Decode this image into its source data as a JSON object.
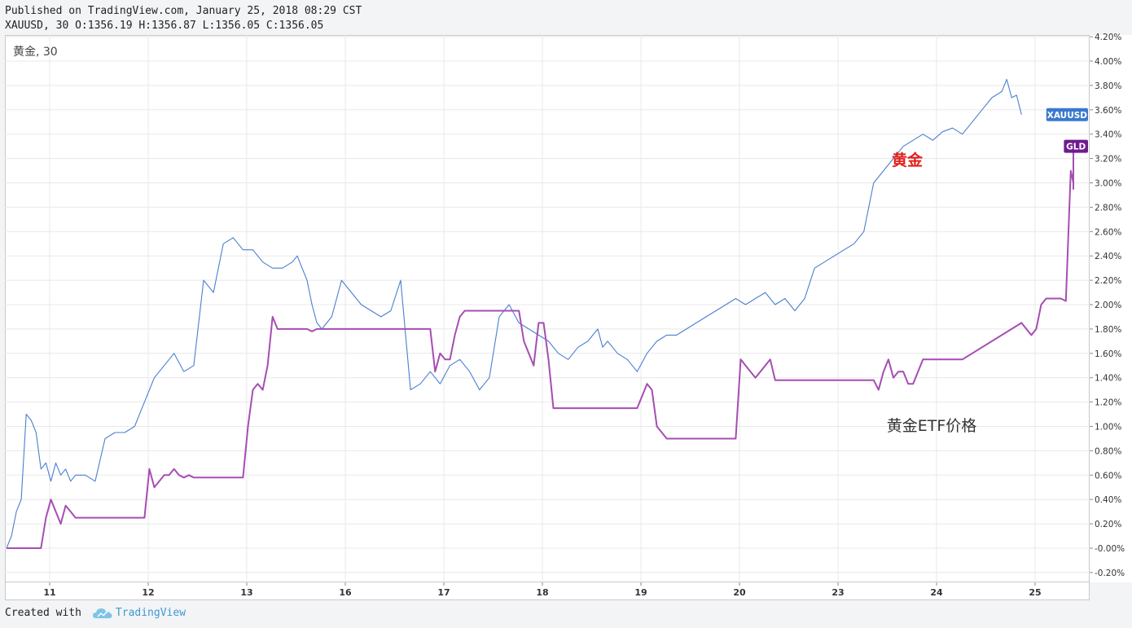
{
  "header": {
    "published": "Published on TradingView.com, January 25, 2018 08:29 CST",
    "symbol_line": "XAUUSD, 30 O:1356.19 H:1356.87 L:1356.05 C:1356.05"
  },
  "pane_label": "黄金, 30",
  "footer": {
    "created_with": "Created with",
    "brand": "TradingView"
  },
  "colors": {
    "xauusd": "#4a7fcf",
    "gld": "#a64db3",
    "gld_tag": "#6f1a8f",
    "annotation_red": "#e0201a",
    "annotation_dark": "#333333",
    "grid": "#e8e8e8"
  },
  "chart_data": {
    "type": "line",
    "x_tick_labels": [
      "11",
      "12",
      "13",
      "16",
      "17",
      "18",
      "19",
      "20",
      "23",
      "24",
      "25"
    ],
    "y_ticks": [
      "4.20%",
      "4.00%",
      "3.80%",
      "3.60%",
      "3.40%",
      "3.20%",
      "3.00%",
      "2.80%",
      "2.60%",
      "2.40%",
      "2.20%",
      "2.00%",
      "1.80%",
      "1.60%",
      "1.40%",
      "1.20%",
      "1.00%",
      "0.80%",
      "0.60%",
      "0.40%",
      "0.20%",
      "-0.00%",
      "-0.20%"
    ],
    "ylim": [
      -0.27,
      4.2
    ],
    "xlim": [
      0,
      11.0
    ],
    "grid": true,
    "annotations": [
      {
        "text": "黄金",
        "color": "#e0201a"
      },
      {
        "text": "黄金ETF价格",
        "color": "#333333"
      }
    ],
    "series": [
      {
        "name": "XAUUSD",
        "color": "#4a7fcf",
        "x": [
          0,
          0.05,
          0.1,
          0.15,
          0.2,
          0.25,
          0.3,
          0.35,
          0.4,
          0.45,
          0.5,
          0.55,
          0.6,
          0.65,
          0.7,
          0.8,
          0.9,
          1.0,
          1.1,
          1.2,
          1.3,
          1.4,
          1.5,
          1.6,
          1.7,
          1.8,
          1.9,
          2.0,
          2.1,
          2.2,
          2.3,
          2.4,
          2.5,
          2.6,
          2.7,
          2.8,
          2.9,
          2.95,
          3.0,
          3.05,
          3.1,
          3.15,
          3.2,
          3.3,
          3.4,
          3.5,
          3.6,
          3.7,
          3.8,
          3.9,
          4.0,
          4.1,
          4.2,
          4.3,
          4.4,
          4.5,
          4.6,
          4.7,
          4.8,
          4.9,
          5.0,
          5.1,
          5.2,
          5.3,
          5.4,
          5.5,
          5.6,
          5.7,
          5.8,
          5.9,
          6.0,
          6.05,
          6.1,
          6.2,
          6.3,
          6.4,
          6.5,
          6.6,
          6.7,
          6.8,
          6.9,
          7.0,
          7.1,
          7.2,
          7.3,
          7.4,
          7.5,
          7.6,
          7.7,
          7.8,
          7.9,
          8.0,
          8.1,
          8.2,
          8.3,
          8.4,
          8.5,
          8.6,
          8.7,
          8.8,
          8.9,
          9.0,
          9.1,
          9.2,
          9.3,
          9.4,
          9.5,
          9.6,
          9.7,
          9.8,
          9.9,
          10.0,
          10.1,
          10.15,
          10.2,
          10.25,
          10.3
        ],
        "values": [
          0.0,
          0.1,
          0.3,
          0.4,
          1.1,
          1.05,
          0.95,
          0.65,
          0.7,
          0.55,
          0.7,
          0.6,
          0.65,
          0.55,
          0.6,
          0.6,
          0.55,
          0.9,
          0.95,
          0.95,
          1.0,
          1.2,
          1.4,
          1.5,
          1.6,
          1.45,
          1.5,
          2.2,
          2.1,
          2.5,
          2.55,
          2.45,
          2.45,
          2.35,
          2.3,
          2.3,
          2.35,
          2.4,
          2.3,
          2.2,
          2.0,
          1.85,
          1.8,
          1.9,
          2.2,
          2.1,
          2.0,
          1.95,
          1.9,
          1.95,
          2.2,
          1.3,
          1.35,
          1.45,
          1.35,
          1.5,
          1.55,
          1.45,
          1.3,
          1.4,
          1.9,
          2.0,
          1.85,
          1.8,
          1.75,
          1.7,
          1.6,
          1.55,
          1.65,
          1.7,
          1.8,
          1.65,
          1.7,
          1.6,
          1.55,
          1.45,
          1.6,
          1.7,
          1.75,
          1.75,
          1.8,
          1.85,
          1.9,
          1.95,
          2.0,
          2.05,
          2.0,
          2.05,
          2.1,
          2.0,
          2.05,
          1.95,
          2.05,
          2.3,
          2.35,
          2.4,
          2.45,
          2.5,
          2.6,
          3.0,
          3.1,
          3.2,
          3.3,
          3.35,
          3.4,
          3.35,
          3.42,
          3.45,
          3.4,
          3.5,
          3.6,
          3.7,
          3.75,
          3.85,
          3.7,
          3.72,
          3.56
        ]
      },
      {
        "name": "GLD",
        "color": "#a64db3",
        "x": [
          0,
          0.35,
          0.4,
          0.45,
          0.5,
          0.55,
          0.6,
          0.65,
          0.7,
          1.4,
          1.45,
          1.5,
          1.55,
          1.6,
          1.65,
          1.7,
          1.75,
          1.8,
          1.85,
          1.9,
          2.4,
          2.45,
          2.5,
          2.55,
          2.6,
          2.65,
          2.7,
          2.75,
          3.05,
          3.1,
          3.15,
          3.2,
          4.3,
          4.35,
          4.4,
          4.45,
          4.5,
          4.55,
          4.6,
          4.65,
          4.7,
          5.2,
          5.25,
          5.3,
          5.35,
          5.4,
          5.45,
          5.5,
          5.55,
          5.6,
          5.65,
          6.4,
          6.45,
          6.5,
          6.55,
          6.6,
          6.65,
          6.7,
          6.75,
          7.4,
          7.45,
          7.5,
          7.55,
          7.6,
          7.65,
          7.7,
          7.75,
          7.8,
          8.8,
          8.85,
          8.9,
          8.95,
          9.0,
          9.05,
          9.1,
          9.15,
          9.2,
          9.25,
          9.3,
          9.35,
          9.4,
          9.45,
          9.5,
          9.55,
          9.6,
          9.65,
          9.7,
          10.3,
          10.35,
          10.4,
          10.45,
          10.5,
          10.55,
          10.6,
          10.65,
          10.7,
          10.75,
          10.8,
          10.85,
          10.9,
          11.0
        ],
        "values": [
          0.0,
          0.0,
          0.25,
          0.4,
          0.3,
          0.2,
          0.35,
          0.3,
          0.25,
          0.25,
          0.65,
          0.5,
          0.55,
          0.6,
          0.6,
          0.65,
          0.6,
          0.58,
          0.6,
          0.58,
          0.58,
          1.0,
          1.3,
          1.35,
          1.3,
          1.5,
          1.9,
          1.8,
          1.8,
          1.78,
          1.8,
          1.8,
          1.8,
          1.45,
          1.6,
          1.55,
          1.55,
          1.75,
          1.9,
          1.95,
          1.95,
          1.95,
          1.7,
          1.6,
          1.5,
          1.85,
          1.85,
          1.55,
          1.15,
          1.15,
          1.15,
          1.15,
          1.25,
          1.35,
          1.3,
          1.0,
          0.95,
          0.9,
          0.9,
          0.9,
          1.55,
          1.5,
          1.45,
          1.4,
          1.45,
          1.5,
          1.55,
          1.38,
          1.38,
          1.3,
          1.45,
          1.55,
          1.4,
          1.45,
          1.45,
          1.35,
          1.35,
          1.45,
          1.55,
          1.55,
          1.55,
          1.55,
          1.55,
          1.55,
          1.55,
          1.55,
          1.55,
          1.85,
          1.8,
          1.75,
          1.8,
          2.0,
          2.05,
          2.05,
          2.05,
          2.05,
          2.03,
          3.1,
          3.0,
          2.95,
          3.35
        ]
      }
    ],
    "last_value_tags": [
      {
        "text": "XAUUSD",
        "value": 3.56,
        "color": "#3a78cf"
      },
      {
        "text": "GLD",
        "value": 3.3,
        "color": "#6f1a8f"
      }
    ]
  }
}
